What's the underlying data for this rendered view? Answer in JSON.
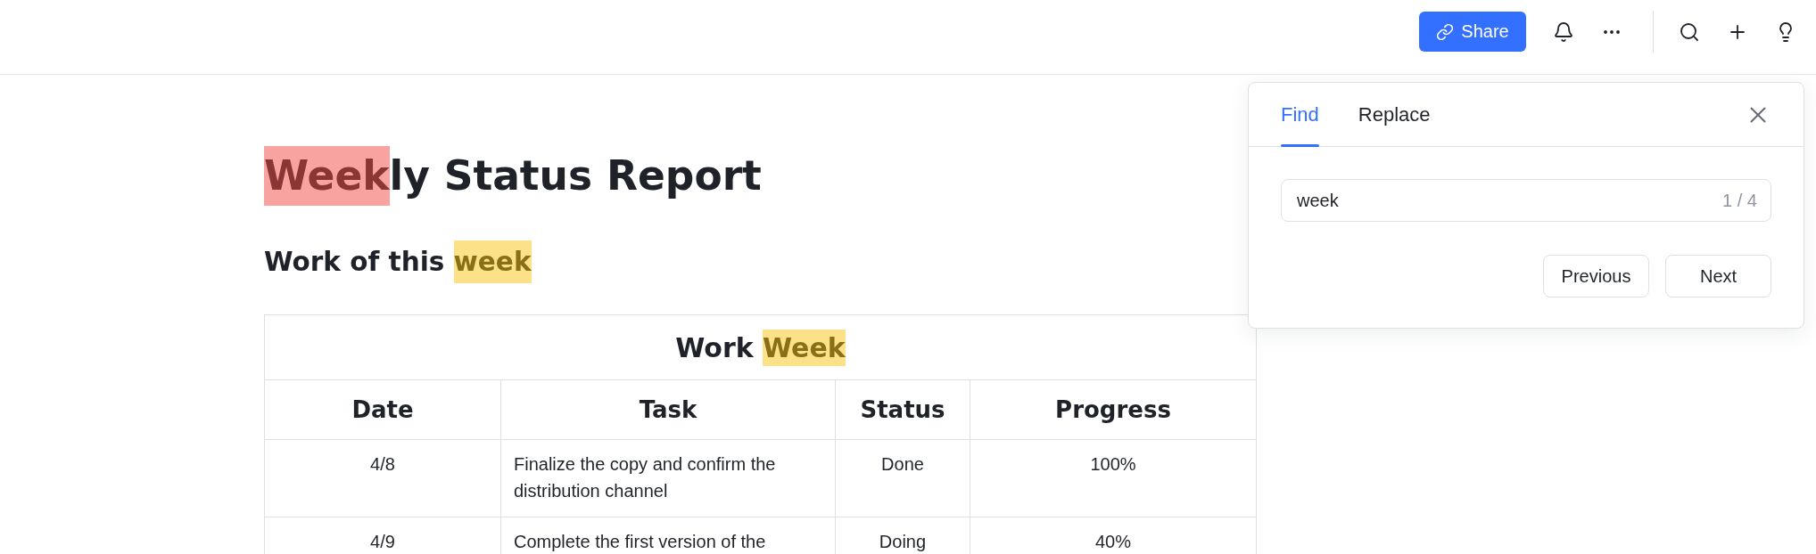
{
  "toolbar": {
    "share_button": {
      "label": "Share"
    }
  },
  "find_panel": {
    "tabs": [
      {
        "label": "Find",
        "selected": true
      },
      {
        "label": "Replace",
        "selected": false
      }
    ],
    "search_field": {
      "value": "week",
      "match_count": "1 / 4"
    },
    "buttons": [
      "Previous",
      "Next"
    ]
  },
  "document": {
    "title": [
      {
        "text": "Week",
        "match": true,
        "selected": true
      },
      {
        "text": "ly Status Report",
        "match": false,
        "selected": false
      }
    ],
    "subtitle": [
      {
        "text": "Work of this ",
        "match": false,
        "selected": false
      },
      {
        "text": "week",
        "match": true,
        "selected": false
      }
    ],
    "table": {
      "title": [
        {
          "text": "Work ",
          "match": false,
          "selected": false
        },
        {
          "text": "Week",
          "match": true,
          "selected": false
        }
      ],
      "columns": [
        "Date",
        "Task",
        "Status",
        "Progress"
      ],
      "rows": [
        [
          "4/8",
          "Finalize the copy and confirm the distribution channel",
          "Done",
          "100%"
        ],
        [
          "4/9",
          "Complete the first version of the",
          "Doing",
          "40%"
        ]
      ]
    }
  }
}
